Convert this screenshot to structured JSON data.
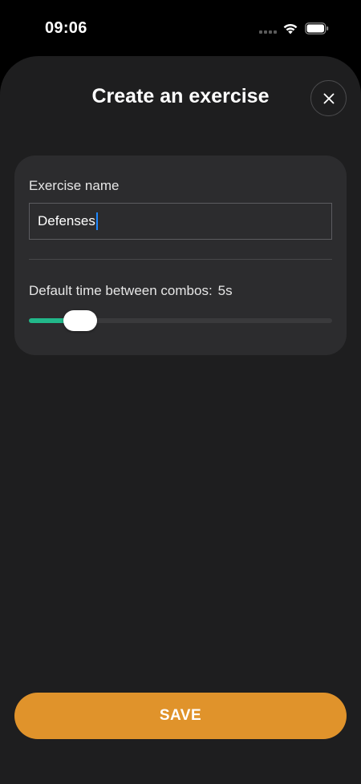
{
  "status_bar": {
    "time": "09:06",
    "icons": [
      "signal-dots-icon",
      "wifi-icon",
      "battery-icon"
    ]
  },
  "sheet": {
    "title": "Create an exercise",
    "close_icon": "close-icon"
  },
  "form": {
    "name_label": "Exercise name",
    "name_value": "Defenses",
    "time_label": "Default time between combos:",
    "time_value": "5s",
    "slider_fraction": 0.17
  },
  "actions": {
    "save_label": "SAVE"
  },
  "colors": {
    "background": "#1e1e1f",
    "card": "#2c2c2e",
    "accent_green": "#22b88a",
    "save_orange": "#e0932b",
    "caret_blue": "#1e88ff"
  }
}
